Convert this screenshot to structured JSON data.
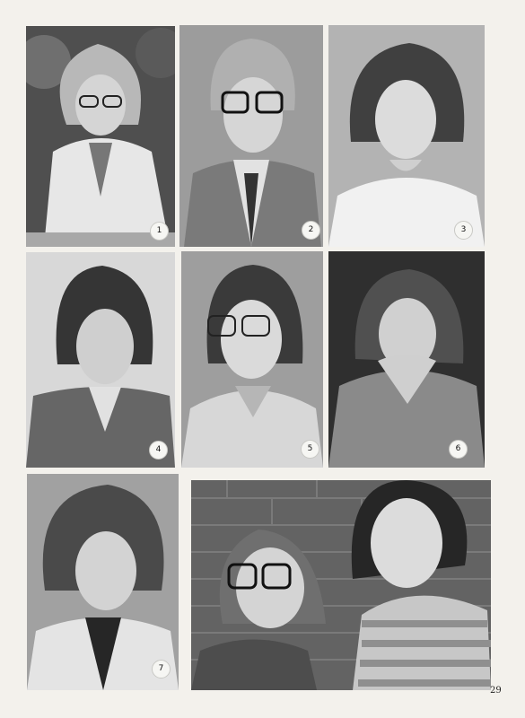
{
  "page": {
    "number": "29"
  },
  "photos": [
    {
      "id": "1",
      "number": "1",
      "subject": "girl-blazer-glasses"
    },
    {
      "id": "2",
      "number": "2",
      "subject": "boy-plaid-jacket-glasses"
    },
    {
      "id": "3",
      "number": "3",
      "subject": "boy-white-tshirt"
    },
    {
      "id": "4",
      "number": "4",
      "subject": "boy-leather-jacket"
    },
    {
      "id": "5",
      "number": "5",
      "subject": "boy-striped-shirt-glasses"
    },
    {
      "id": "6",
      "number": "6",
      "subject": "girl-plaid-shirt-scarf"
    },
    {
      "id": "7",
      "number": "7",
      "subject": "boy-curly-hair"
    },
    {
      "id": "8",
      "number": "",
      "subject": "two-students-brick-wall"
    }
  ]
}
